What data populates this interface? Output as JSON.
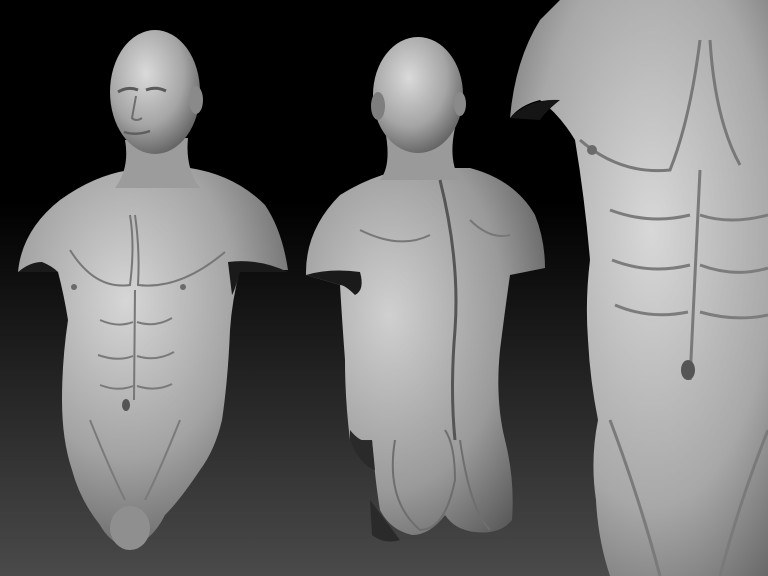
{
  "scene": {
    "kind": "3d-sculpt-render",
    "background_top": "#000000",
    "background_bottom": "#4a4a4a",
    "clay_highlight": "#d4d4d4",
    "clay_mid": "#9a9a9a",
    "clay_shadow": "#4a4a4a"
  },
  "views": [
    {
      "id": "front",
      "description_label": "front-view"
    },
    {
      "id": "back",
      "description_label": "back-view"
    },
    {
      "id": "closeup",
      "description_label": "torso-closeup"
    }
  ]
}
